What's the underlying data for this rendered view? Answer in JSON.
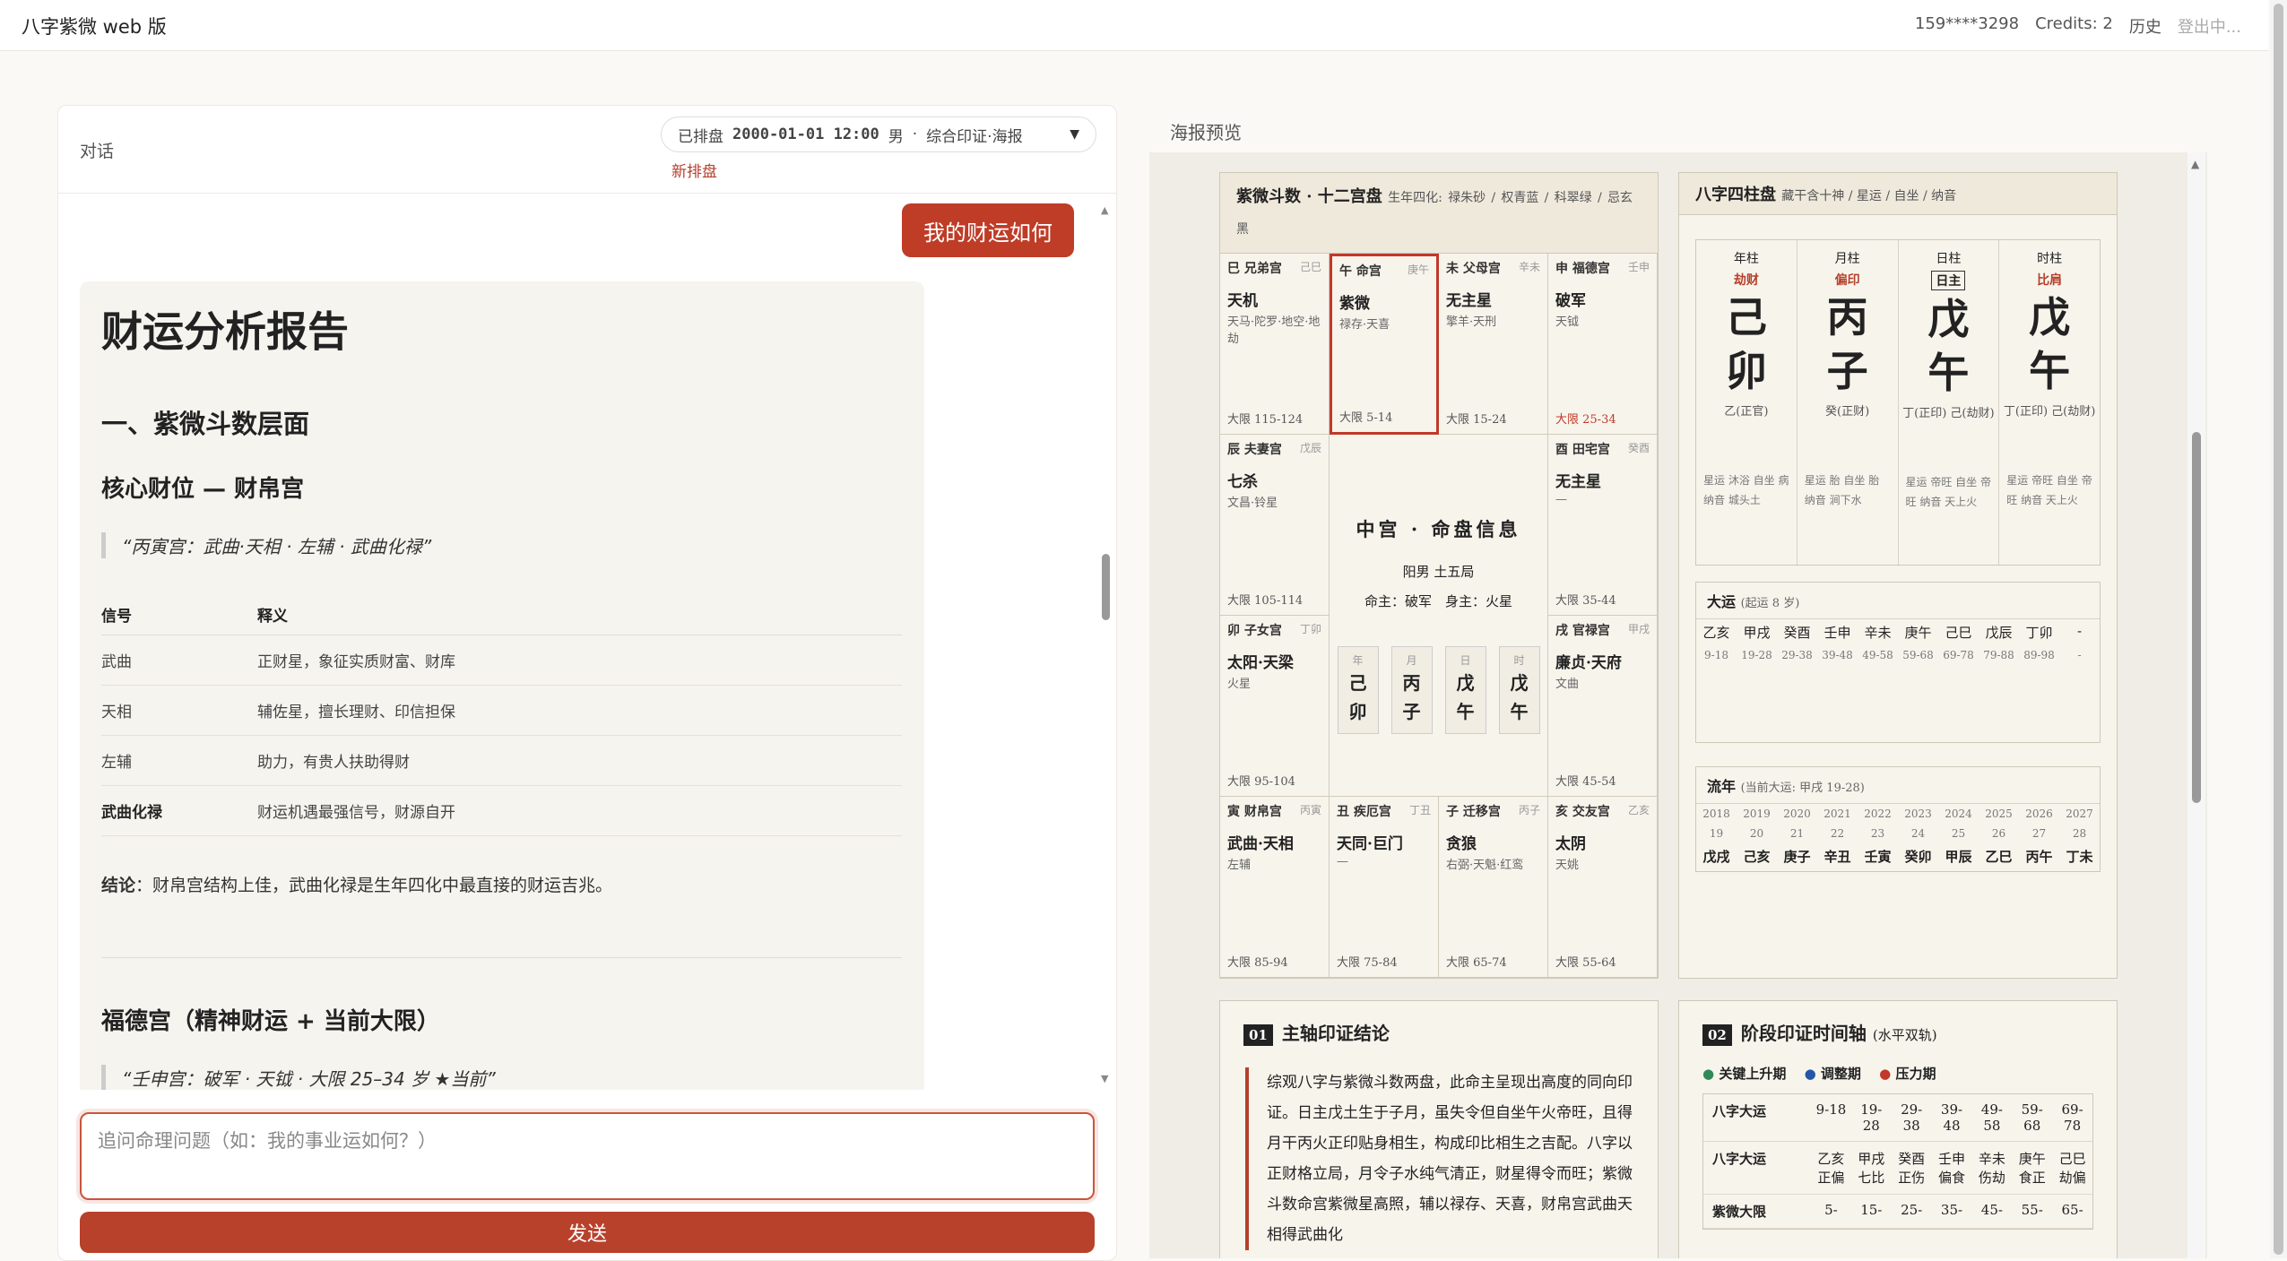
{
  "app": {
    "title": "八字紫微 web 版",
    "phone": "159****3298",
    "credits": "Credits: 2",
    "history": "历史",
    "logout": "登出中..."
  },
  "chat": {
    "title": "对话",
    "pill_label": "已排盘",
    "pill_datetime": "2000-01-01 12:00",
    "pill_gender": "男",
    "pill_mode": "综合印证·海报",
    "new_chart": "新排盘",
    "user_msg": "我的财运如何",
    "input_placeholder": "追问命理问题（如：我的事业运如何？）",
    "send": "发送"
  },
  "report": {
    "h1": "财运分析报告",
    "h2": "一、紫微斗数层面",
    "h3a": "核心财位 — 财帛宫",
    "quote_a": "“丙寅宫：武曲·天相 · 左辅 · 武曲化禄”",
    "th1": "信号",
    "th2": "释义",
    "rows": [
      {
        "k": "武曲",
        "v": "正财星，象征实质财富、财库"
      },
      {
        "k": "天相",
        "v": "辅佐星，擅长理财、印信担保"
      },
      {
        "k": "左辅",
        "v": "助力，有贵人扶助得财"
      },
      {
        "k": "武曲化禄",
        "v": "财运机遇最强信号，财源自开"
      }
    ],
    "concl_k": "结论",
    "concl": "：财帛宫结构上佳，武曲化禄是生年四化中最直接的财运吉兆。",
    "h3b": "福德宫（精神财运 + 当前大限）",
    "quote_b": "“壬申宫：破军 · 天钺 · 大限 25–34 岁 ★当前”"
  },
  "poster": {
    "title": "海报预览",
    "ziwei": {
      "title": "紫微斗数 · 十二宫盘",
      "sihua": "生年四化:",
      "lu": "禄朱砂",
      "quan": "权青蓝",
      "ke": "科翠绿",
      "ji": "忌玄黑",
      "cells": [
        {
          "nm": "巳 兄弟宫",
          "br": "己巳",
          "st": "天机",
          "sub": "天马·陀罗·地空·地劫",
          "dx": "大限 115-124"
        },
        {
          "nm": "午 命宫",
          "br": "庚午",
          "st": "紫微",
          "sub": "禄存·天喜",
          "dx": "大限 5-14"
        },
        {
          "nm": "未 父母宫",
          "br": "辛未",
          "st": "无主星",
          "sub": "擎羊·天刑",
          "dx": "大限 15-24"
        },
        {
          "nm": "申 福德宫",
          "br": "壬申",
          "st": "破军",
          "sub": "天钺",
          "dx": "大限 25-34"
        },
        {
          "nm": "辰 夫妻宫",
          "br": "戊辰",
          "st": "七杀",
          "sub": "文昌·铃星",
          "dx": "大限 105-114"
        },
        {
          "nm": "酉 田宅宫",
          "br": "癸酉",
          "st": "无主星",
          "sub": "—",
          "dx": "大限 35-44"
        },
        {
          "nm": "卯 子女宫",
          "br": "丁卯",
          "st": "太阳·天梁",
          "sub": "火星",
          "dx": "大限 95-104"
        },
        {
          "nm": "戌 官禄宫",
          "br": "甲戌",
          "st": "廉贞·天府",
          "sub": "文曲",
          "dx": "大限 45-54"
        },
        {
          "nm": "寅 财帛宫",
          "br": "丙寅",
          "st": "武曲·天相",
          "sub": "左辅",
          "dx": "大限 85-94"
        },
        {
          "nm": "丑 疾厄宫",
          "br": "丁丑",
          "st": "天同·巨门",
          "sub": "—",
          "dx": "大限 75-84"
        },
        {
          "nm": "子 迁移宫",
          "br": "丙子",
          "st": "贪狼",
          "sub": "右弼·天魁·红鸾",
          "dx": "大限 65-74"
        },
        {
          "nm": "亥 交友宫",
          "br": "乙亥",
          "st": "太阴",
          "sub": "天姚",
          "dx": "大限 55-64"
        }
      ],
      "center_title": "中宫 · 命盘信息",
      "center_s1": "阳男 土五局",
      "center_s2": "命主：破军　身主：火星",
      "mini": [
        {
          "l": "年",
          "g": "己",
          "z": "卯"
        },
        {
          "l": "月",
          "g": "丙",
          "z": "子"
        },
        {
          "l": "日",
          "g": "戊",
          "z": "午"
        },
        {
          "l": "时",
          "g": "戊",
          "z": "午"
        }
      ]
    },
    "bazi": {
      "title": "八字四柱盘",
      "subtitle": "藏干含十神 / 星运 / 自坐 / 纳音",
      "cols": [
        {
          "l": "年柱",
          "s": "劫财",
          "g": "己",
          "z": "卯",
          "h": "乙(正官)",
          "t": "星运 沐浴 自坐 病 纳音 城头土"
        },
        {
          "l": "月柱",
          "s": "偏印",
          "g": "丙",
          "z": "子",
          "h": "癸(正财)",
          "t": "星运 胎 自坐 胎 纳音 涧下水"
        },
        {
          "l": "日柱",
          "s": "日主",
          "g": "戊",
          "z": "午",
          "h": "丁(正印) 己(劫财)",
          "t": "星运 帝旺 自坐 帝旺 纳音 天上火"
        },
        {
          "l": "时柱",
          "s": "比肩",
          "g": "戊",
          "z": "午",
          "h": "丁(正印) 己(劫财)",
          "t": "星运 帝旺 自坐 帝旺 纳音 天上火"
        }
      ],
      "dayun_title": "大运",
      "dayun_sub": "(起运 8 岁)",
      "dayun": [
        "乙亥",
        "甲戌",
        "癸酉",
        "壬申",
        "辛未",
        "庚午",
        "己巳",
        "戊辰",
        "丁卯",
        "-"
      ],
      "dayun_age": [
        "9-18",
        "19-28",
        "29-38",
        "39-48",
        "49-58",
        "59-68",
        "69-78",
        "79-88",
        "89-98",
        "-"
      ],
      "liunian_title": "流年",
      "liunian_sub": "(当前大运: 甲戌 19-28)",
      "ln_year": [
        "2018",
        "2019",
        "2020",
        "2021",
        "2022",
        "2023",
        "2024",
        "2025",
        "2026",
        "2027"
      ],
      "ln_age": [
        "19",
        "20",
        "21",
        "22",
        "23",
        "24",
        "25",
        "26",
        "27",
        "28"
      ],
      "ln_gz": [
        "戊戌",
        "己亥",
        "庚子",
        "辛丑",
        "壬寅",
        "癸卯",
        "甲辰",
        "乙巳",
        "丙午",
        "丁未"
      ]
    },
    "sec1": {
      "num": "01",
      "title": "主轴印证结论",
      "text": "综观八字与紫微斗数两盘，此命主呈现出高度的同向印证。日主戊土生于子月，虽失令但自坐午火帝旺，且得月干丙火正印贴身相生，构成印比相生之吉配。八字以正财格立局，月令子水纯气清正，财星得令而旺；紫微斗数命宫紫微星高照，辅以禄存、天喜，财帛宫武曲天相得武曲化"
    },
    "sec2": {
      "num": "02",
      "title": "阶段印证时间轴",
      "sub": "(水平双轨)",
      "l1": "关键上升期",
      "l2": "调整期",
      "l3": "压力期",
      "rows": [
        {
          "k": "八字大运",
          "v": [
            "9-18",
            "19-28",
            "29-38",
            "39-48",
            "49-58",
            "59-68",
            "69-78"
          ]
        },
        {
          "k": "八字大运",
          "v": [
            "乙亥 正偏",
            "甲戌 七比",
            "癸酉 正伤",
            "壬申 偏食",
            "辛未 伤劫",
            "庚午 食正",
            "己巳 劫偏"
          ]
        },
        {
          "k": "紫微大限",
          "v": [
            "5-",
            "15-",
            "25-",
            "35-",
            "45-",
            "55-",
            "65-"
          ]
        }
      ]
    }
  }
}
